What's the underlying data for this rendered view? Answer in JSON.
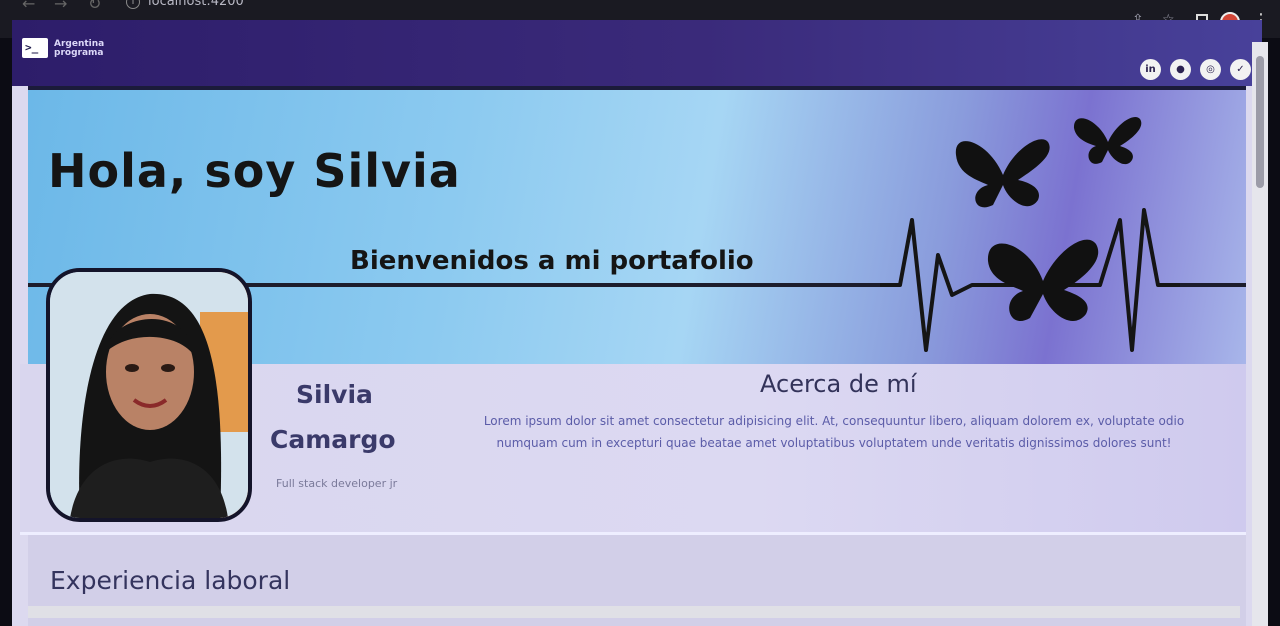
{
  "browser": {
    "url": "localhost:4200",
    "info_glyph": "i"
  },
  "navbar": {
    "logo_glyph": ">_",
    "logo_line1": "Argentina",
    "logo_line2": "programa",
    "social_icons": [
      {
        "name": "linkedin-icon",
        "glyph": "in"
      },
      {
        "name": "github-icon",
        "glyph": "●"
      },
      {
        "name": "instagram-icon",
        "glyph": "◎"
      },
      {
        "name": "twitter-icon",
        "glyph": "✓"
      }
    ]
  },
  "banner": {
    "greeting": "Hola, soy Silvia",
    "welcome": "Bienvenidos a mi portafolio"
  },
  "profile": {
    "first_name": "Silvia",
    "last_name": "Camargo",
    "role": "Full stack developer jr"
  },
  "about": {
    "title": "Acerca de mí",
    "text": "Lorem ipsum dolor sit amet consectetur adipisicing elit. At, consequuntur libero, aliquam dolorem ex, voluptate odio numquam cum in excepturi quae beatae amet voluptatibus voluptatem unde veritatis dignissimos dolores sunt!"
  },
  "experience": {
    "title": "Experiencia laboral"
  },
  "colors": {
    "navbar": "#2d1d6a",
    "banner_blue": "#8ccaf0",
    "card_bg": "#dcd9ef",
    "heading_text": "#3a3a6a",
    "body_text": "#5b5ca8"
  }
}
